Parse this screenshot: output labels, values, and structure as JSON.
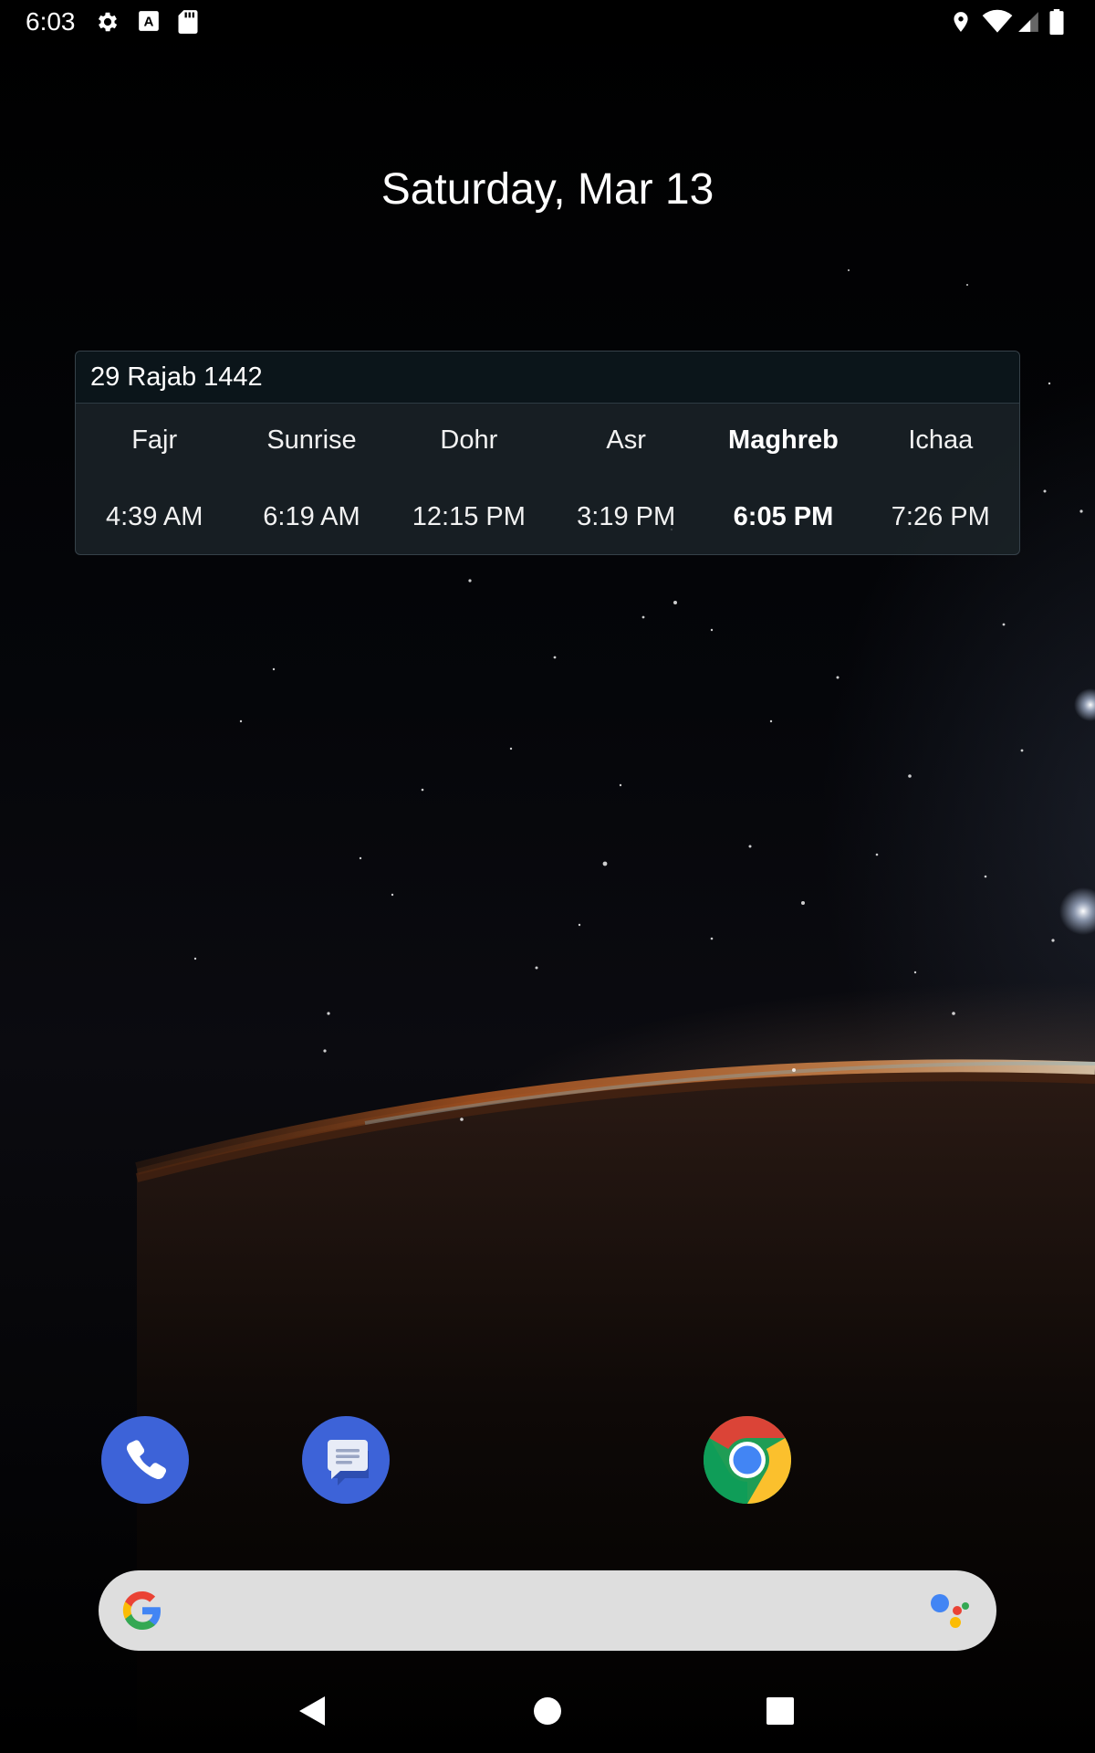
{
  "status_bar": {
    "time": "6:03",
    "left_icons": [
      "gear-icon",
      "keyboard-a-icon",
      "sd-card-icon"
    ],
    "right_icons": [
      "location-icon",
      "wifi-icon",
      "signal-icon",
      "battery-icon"
    ]
  },
  "home": {
    "date": "Saturday, Mar 13"
  },
  "prayer_widget": {
    "hijri_date": "29 Rajab 1442",
    "prayers": [
      {
        "name": "Fajr",
        "time": "4:39 AM"
      },
      {
        "name": "Sunrise",
        "time": "6:19 AM"
      },
      {
        "name": "Dohr",
        "time": "12:15 PM"
      },
      {
        "name": "Asr",
        "time": "3:19 PM"
      },
      {
        "name": "Maghreb",
        "time": "6:05 PM"
      },
      {
        "name": "Ichaa",
        "time": "7:26 PM"
      }
    ],
    "current_prayer": "Maghreb"
  },
  "dock": {
    "apps": [
      "phone-icon",
      "messages-icon",
      "chrome-icon"
    ]
  },
  "search_bar": {
    "icons": [
      "google-g-icon",
      "google-assistant-icon"
    ]
  },
  "nav_bar": {
    "buttons": [
      "back-icon",
      "home-icon",
      "recents-icon"
    ]
  },
  "colors": {
    "widget_bg": "#1c242a",
    "app_blue": "#3d63d8",
    "search_bg": "#dedede"
  }
}
